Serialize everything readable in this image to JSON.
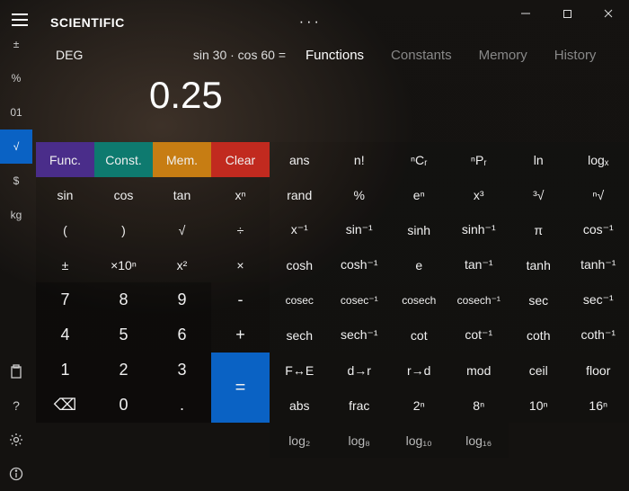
{
  "window": {
    "minimize": "−",
    "maximize": "□",
    "close": "×"
  },
  "header": {
    "title": "SCIENTIFIC",
    "more": "···",
    "mode": "DEG",
    "expression": "sin 30 · cos 60 =",
    "result": "0.25",
    "tabs": {
      "functions": "Functions",
      "constants": "Constants",
      "memory": "Memory",
      "history": "History"
    }
  },
  "rail": {
    "plusminus": "±",
    "percent": "%",
    "zeroone": "01",
    "sqrt": "√",
    "dollar": "$",
    "kg": "kg"
  },
  "top_buttons": {
    "func": "Func.",
    "const": "Const.",
    "mem": "Mem.",
    "clear": "Clear"
  },
  "row1": {
    "ans": "ans",
    "fact": "n!",
    "ncr": "ⁿCᵣ",
    "npr": "ⁿPᵣ",
    "ln": "ln",
    "logx": "logₓ"
  },
  "row2": {
    "sin": "sin",
    "cos": "cos",
    "tan": "tan",
    "xn": "xⁿ",
    "rand": "rand",
    "pct": "%",
    "en": "eⁿ",
    "x3": "x³",
    "root3": "³√",
    "rootn": "ⁿ√"
  },
  "row3": {
    "lp": "(",
    "rp": ")",
    "sqrt": "√",
    "div": "÷",
    "xinv": "x⁻¹",
    "sininv": "sin⁻¹",
    "sinh": "sinh",
    "sinhinv": "sinh⁻¹",
    "pi": "π",
    "cosinv": "cos⁻¹"
  },
  "row4": {
    "pm": "±",
    "x10n": "×10ⁿ",
    "x2": "x²",
    "mul": "×",
    "cosh": "cosh",
    "coshinv": "cosh⁻¹",
    "e": "e",
    "taninv": "tan⁻¹",
    "tanh": "tanh",
    "tanhinv": "tanh⁻¹"
  },
  "row5": {
    "n7": "7",
    "n8": "8",
    "n9": "9",
    "minus": "-",
    "cosec": "cosec",
    "cosecinv": "cosec⁻¹",
    "cosech": "cosech",
    "cosechinv": "cosech⁻¹",
    "sec": "sec",
    "secinv": "sec⁻¹"
  },
  "row6": {
    "n4": "4",
    "n5": "5",
    "n6": "6",
    "plus": "+",
    "sech": "sech",
    "sechinv": "sech⁻¹",
    "cot": "cot",
    "cotinv": "cot⁻¹",
    "coth": "coth",
    "cothinv": "coth⁻¹"
  },
  "row7": {
    "n1": "1",
    "n2": "2",
    "n3": "3",
    "eq": "=",
    "fe": "F↔E",
    "dr": "d→r",
    "rd": "r→d",
    "mod": "mod",
    "ceil": "ceil",
    "floor": "floor"
  },
  "row8": {
    "back": "⌫",
    "n0": "0",
    "dot": ".",
    "abs": "abs",
    "frac": "frac",
    "p2n": "2ⁿ",
    "p8n": "8ⁿ",
    "p10n": "10ⁿ",
    "p16n": "16ⁿ"
  },
  "row9": {
    "log2": "log₂",
    "log8": "log₈",
    "log10": "log₁₀",
    "log16": "log₁₆"
  }
}
